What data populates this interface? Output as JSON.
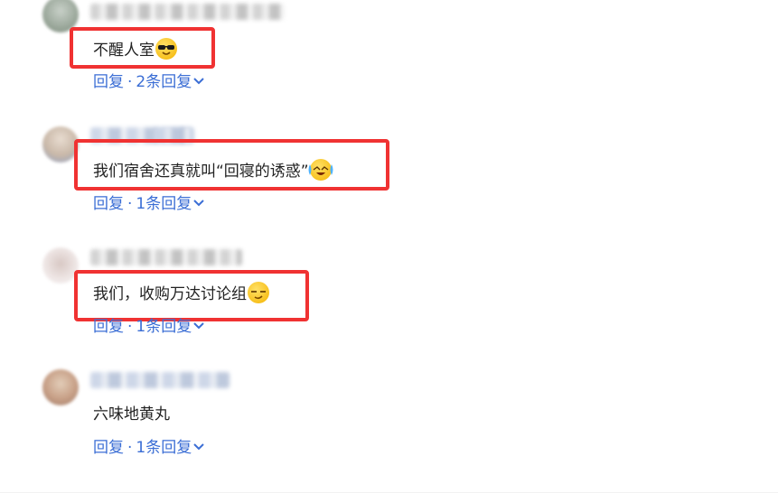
{
  "comments": [
    {
      "text": "不醒人室",
      "emoji": "sunglasses-emoji",
      "reply_label": "回复",
      "sep": "·",
      "replies_label": "2条回复",
      "highlighted": true
    },
    {
      "text": "我们宿舍还真就叫“回寝的诱惑”",
      "emoji": "crying-laugh-emoji",
      "reply_label": "回复",
      "sep": "·",
      "replies_label": "1条回复",
      "highlighted": true
    },
    {
      "text": "我们，收购万达讨论组",
      "emoji": "smirk-emoji",
      "reply_label": "回复",
      "sep": "·",
      "replies_label": "1条回复",
      "highlighted": true
    },
    {
      "text": "六味地黄丸",
      "emoji": "",
      "reply_label": "回复",
      "sep": "·",
      "replies_label": "1条回复",
      "highlighted": false
    }
  ],
  "colors": {
    "highlight": "#f03232",
    "link": "#3b6ed5",
    "text": "#222222"
  }
}
